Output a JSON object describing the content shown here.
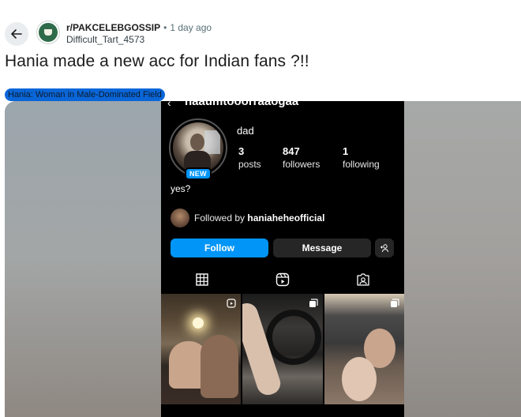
{
  "post": {
    "subreddit": "r/PAKCELEBGOSSIP",
    "separator": "•",
    "time": "1 day ago",
    "author": "Difficult_Tart_4573",
    "title": "Hania made a new acc for Indian fans ?!!",
    "flair": "Hania: Woman in Male-Dominated Field",
    "flair_color": "#0a66d8"
  },
  "instagram": {
    "handle": "naaumtooorraaogaa",
    "avatar_badge": "NEW",
    "display_name": "dad",
    "stats": [
      {
        "num": "3",
        "label": "posts"
      },
      {
        "num": "847",
        "label": "followers"
      },
      {
        "num": "1",
        "label": "following"
      }
    ],
    "bio": "yes?",
    "followed_by_prefix": "Followed by ",
    "followed_by_user": "haniaheheofficial",
    "follow_label": "Follow",
    "message_label": "Message",
    "accent": "#0095f6",
    "tabs": [
      "grid-icon",
      "reels-icon",
      "tagged-icon"
    ]
  }
}
